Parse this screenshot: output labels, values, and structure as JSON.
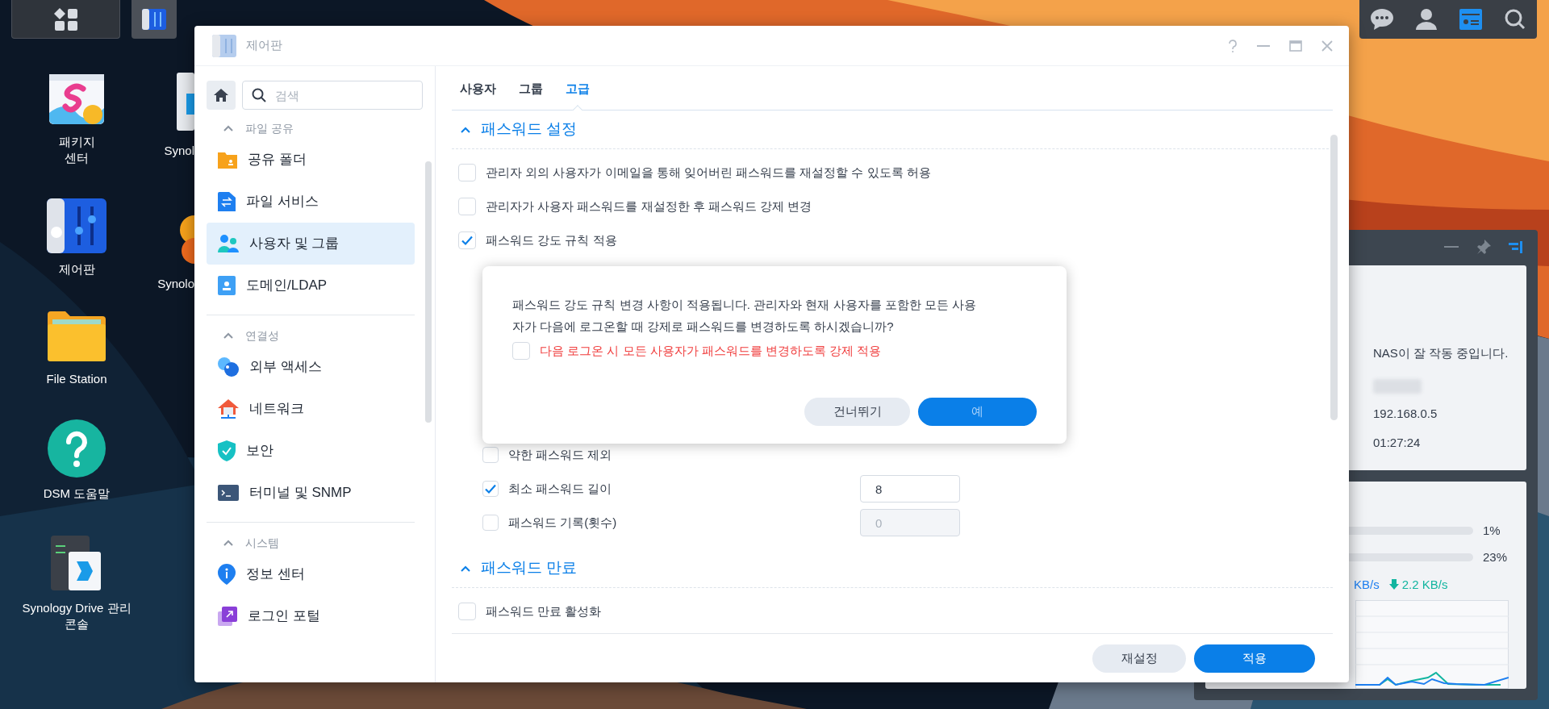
{
  "desktop_icons": [
    {
      "kind": "package",
      "label_lines": [
        "패키지",
        "센터"
      ]
    },
    {
      "kind": "control",
      "label_lines": [
        "제어판"
      ]
    },
    {
      "kind": "folder",
      "label_lines": [
        "File Station"
      ]
    },
    {
      "kind": "help",
      "label_lines": [
        "DSM 도움말"
      ]
    },
    {
      "kind": "drive",
      "label_lines": [
        "Synology Drive 관리",
        "콘솔"
      ]
    }
  ],
  "desktop_icons_partial": [
    {
      "kind": "sliver",
      "label": "Synol"
    },
    {
      "kind": "orange",
      "label": "Synolo"
    }
  ],
  "window": {
    "title": "제어판",
    "search": {
      "placeholder": "검색"
    },
    "sidebar": [
      {
        "title": "파일 공유",
        "expanded": true,
        "items": [
          {
            "kind": "folder",
            "label": "공유 폴더",
            "selected": false
          },
          {
            "kind": "file-service",
            "label": "파일 서비스",
            "selected": false
          },
          {
            "kind": "users",
            "label": "사용자 및 그룹",
            "selected": true
          },
          {
            "kind": "domain",
            "label": "도메인/LDAP",
            "selected": false
          }
        ]
      },
      {
        "title": "연결성",
        "expanded": true,
        "items": [
          {
            "kind": "external",
            "label": "외부 액세스",
            "selected": false
          },
          {
            "kind": "network",
            "label": "네트워크",
            "selected": false
          },
          {
            "kind": "security",
            "label": "보안",
            "selected": false
          },
          {
            "kind": "terminal",
            "label": "터미널 및 SNMP",
            "selected": false
          }
        ]
      },
      {
        "title": "시스템",
        "expanded": true,
        "items": [
          {
            "kind": "info",
            "label": "정보 센터",
            "selected": false
          },
          {
            "kind": "portal",
            "label": "로그인 포털",
            "selected": false
          }
        ]
      }
    ],
    "tabs": [
      {
        "label": "사용자",
        "selected": false
      },
      {
        "label": "그룹",
        "selected": false
      },
      {
        "label": "고급",
        "selected": true
      }
    ],
    "sections": [
      {
        "title": "패스워드 설정",
        "expanded": true,
        "rows": [
          {
            "label": "관리자 외의 사용자가 이메일을 통해 잊어버린 패스워드를 재설정할 수 있도록 허용",
            "checked": false
          },
          {
            "label": "관리자가 사용자 패스워드를 재설정한 후 패스워드 강제 변경",
            "checked": false
          },
          {
            "label": "패스워드 강도 규칙 적용",
            "checked": true,
            "children": [
              {
                "label": "약한 패스워드 제외",
                "checked": false
              },
              {
                "label": "최소 패스워드 길이",
                "checked": true,
                "field": {
                  "value": "8",
                  "disabled": false
                }
              },
              {
                "label": "패스워드 기록(횟수)",
                "checked": false,
                "field": {
                  "value": "0",
                  "disabled": true
                }
              }
            ]
          }
        ]
      },
      {
        "title": "패스워드 만료",
        "expanded": true,
        "rows": [
          {
            "label": "패스워드 만료 활성화",
            "checked": false
          }
        ]
      }
    ],
    "footer_buttons": [
      {
        "label": "재설정",
        "kind": "secondary"
      },
      {
        "label": "적용",
        "kind": "primary"
      }
    ]
  },
  "dialog": {
    "message": "패스워드 강도 규칙 변경 사항이 적용됩니다. 관리자와 현재 사용자를 포함한 모든 사용자가 다음에 로그온할 때 강제로 패스워드를 변경하도록 하시겠습니까?",
    "option": {
      "label": "다음 로그온 시 모든 사용자가 패스워드를 변경하도록 강제 적용",
      "checked": false
    },
    "buttons": [
      {
        "label": "건너뛰기",
        "kind": "secondary"
      },
      {
        "label": "예",
        "kind": "primary"
      }
    ]
  },
  "widget": {
    "status": "NAS이 잘 작동 중입니다.",
    "info": [
      "192.168.0.5",
      "01:27:24"
    ],
    "usage": [
      "1%",
      "23%"
    ],
    "upload": "KB/s",
    "download": "2.2 KB/s"
  }
}
